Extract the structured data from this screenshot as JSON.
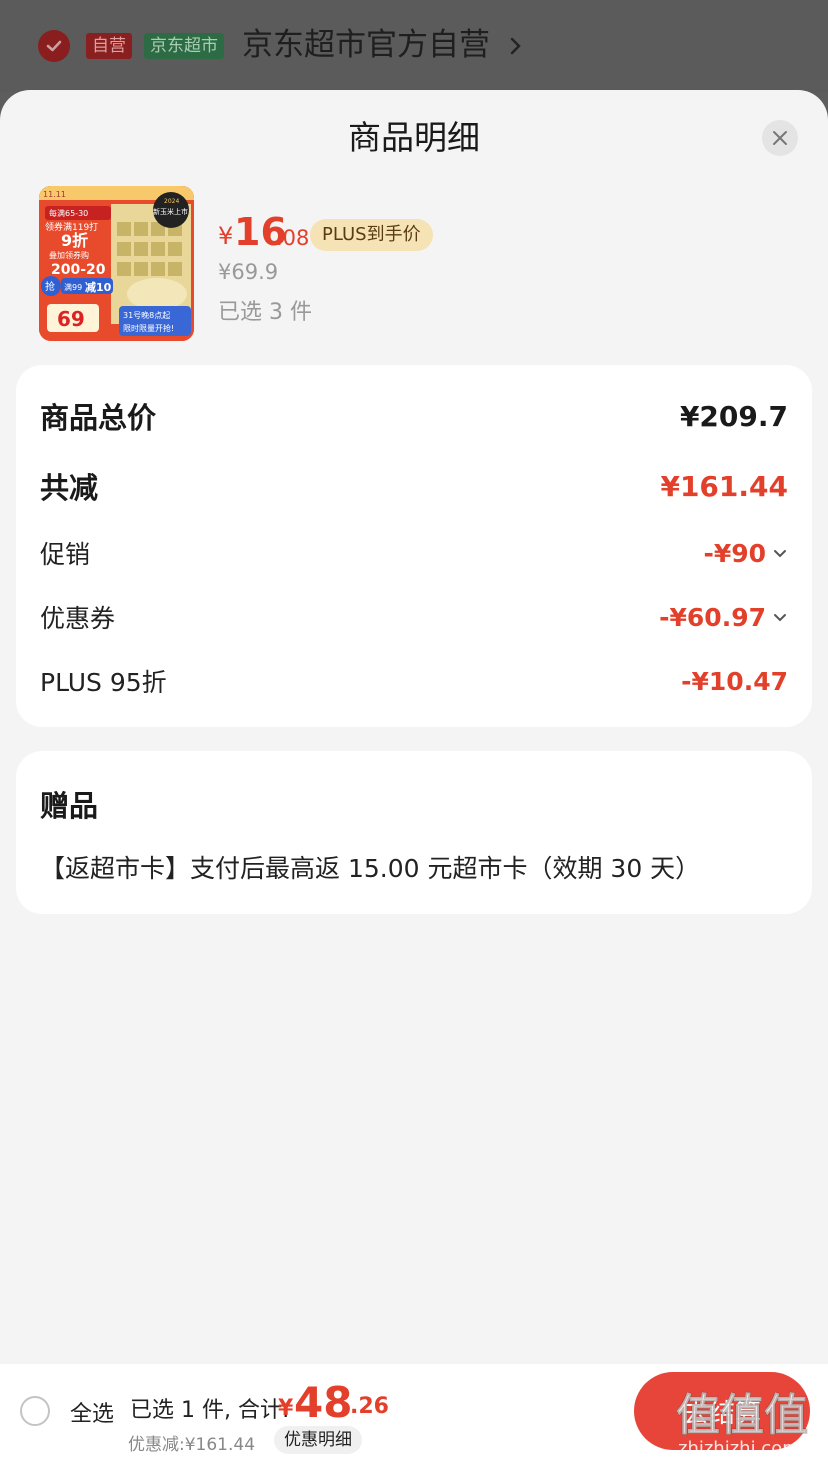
{
  "store": {
    "tag_self": "自营",
    "tag_market": "京东超市",
    "name": "京东超市官方自营"
  },
  "sheet": {
    "title": "商品明细"
  },
  "product": {
    "price_symbol": "¥",
    "price_int": "16",
    "price_dec": ".08",
    "plus_badge": "PLUS到手价",
    "original_price": "¥69.9",
    "selected": "已选 3 件",
    "image_texts": [
      "11.11",
      "每满65-30",
      "领券满119打",
      "9折",
      "叠加领券购",
      "200-20",
      "抢",
      "满99",
      "减10",
      "69",
      "31号晚8点起",
      "限时限量开抢!",
      "新玉米上市",
      "2024"
    ]
  },
  "breakdown": {
    "total_label": "商品总价",
    "total_value": "¥209.7",
    "reduce_label": "共减",
    "reduce_value": "¥161.44",
    "promo_label": "促销",
    "promo_value": "-¥90",
    "coupon_label": "优惠券",
    "coupon_value": "-¥60.97",
    "plus_label": "PLUS 95折",
    "plus_value": "-¥10.47"
  },
  "gift": {
    "title": "赠品",
    "text": "【返超市卡】支付后最高返 15.00 元超市卡（效期 30 天）"
  },
  "bottom": {
    "select_all": "全选",
    "summary": "已选 1 件, 合计:",
    "total_symbol": "¥",
    "total_int": "48",
    "total_dec": ".26",
    "saved": "优惠减:¥161.44",
    "detail_button": "优惠明细",
    "checkout": "去结算"
  },
  "watermark": {
    "brand": "值值值",
    "domain": "zhizhizhi.com"
  },
  "colors": {
    "accent_red": "#e2402a",
    "plus_badge_bg": "#f6e3b5",
    "sheet_bg": "#f4f4f4",
    "market_green": "#2d6b45"
  }
}
